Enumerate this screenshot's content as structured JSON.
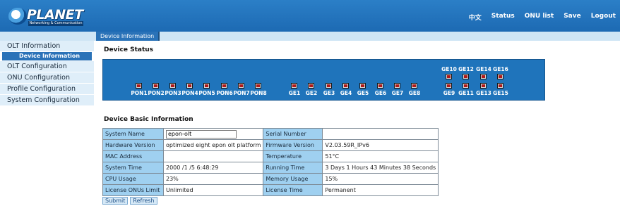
{
  "brand": {
    "name": "PLANET",
    "tagline": "Networking & Communication"
  },
  "topnav": [
    "中文",
    "Status",
    "ONU list",
    "Save",
    "Logout"
  ],
  "tab": "Device Information",
  "sidebar": {
    "items": [
      "OLT Information",
      "OLT Configuration",
      "ONU Configuration",
      "Profile Configuration",
      "System Configuration"
    ],
    "sub": "Device Information"
  },
  "device_status": {
    "title": "Device Status",
    "pon_ports": [
      "PON1",
      "PON2",
      "PON3",
      "PON4",
      "PON5",
      "PON6",
      "PON7",
      "PON8"
    ],
    "ge_ports": [
      "GE1",
      "GE2",
      "GE3",
      "GE4",
      "GE5",
      "GE6",
      "GE7",
      "GE8"
    ],
    "ge_upper": [
      "GE10",
      "GE12",
      "GE14",
      "GE16"
    ],
    "ge_lower": [
      "GE9",
      "GE11",
      "GE13",
      "GE15"
    ]
  },
  "basic_info": {
    "title": "Device Basic Information",
    "rows": [
      {
        "k1": "System Name",
        "v1": "epon-olt",
        "k2": "Serial Number",
        "v2": ""
      },
      {
        "k1": "Hardware Version",
        "v1": "optimized eight epon olt platform",
        "k2": "Firmware Version",
        "v2": "V2.03.59R_IPv6"
      },
      {
        "k1": "MAC Address",
        "v1": "",
        "k2": "Temperature",
        "v2": "51°C"
      },
      {
        "k1": "System Time",
        "v1": "2000 /1 /5 6:48:29",
        "k2": "Running Time",
        "v2": "3 Days 1 Hours 43 Minutes 38 Seconds"
      },
      {
        "k1": "CPU Usage",
        "v1": "23%",
        "k2": "Memory Usage",
        "v2": "15%"
      },
      {
        "k1": "License ONUs Limit",
        "v1": "Unlimited",
        "k2": "License Time",
        "v2": "Permanent"
      }
    ]
  },
  "buttons": {
    "submit": "Submit",
    "refresh": "Refresh"
  }
}
